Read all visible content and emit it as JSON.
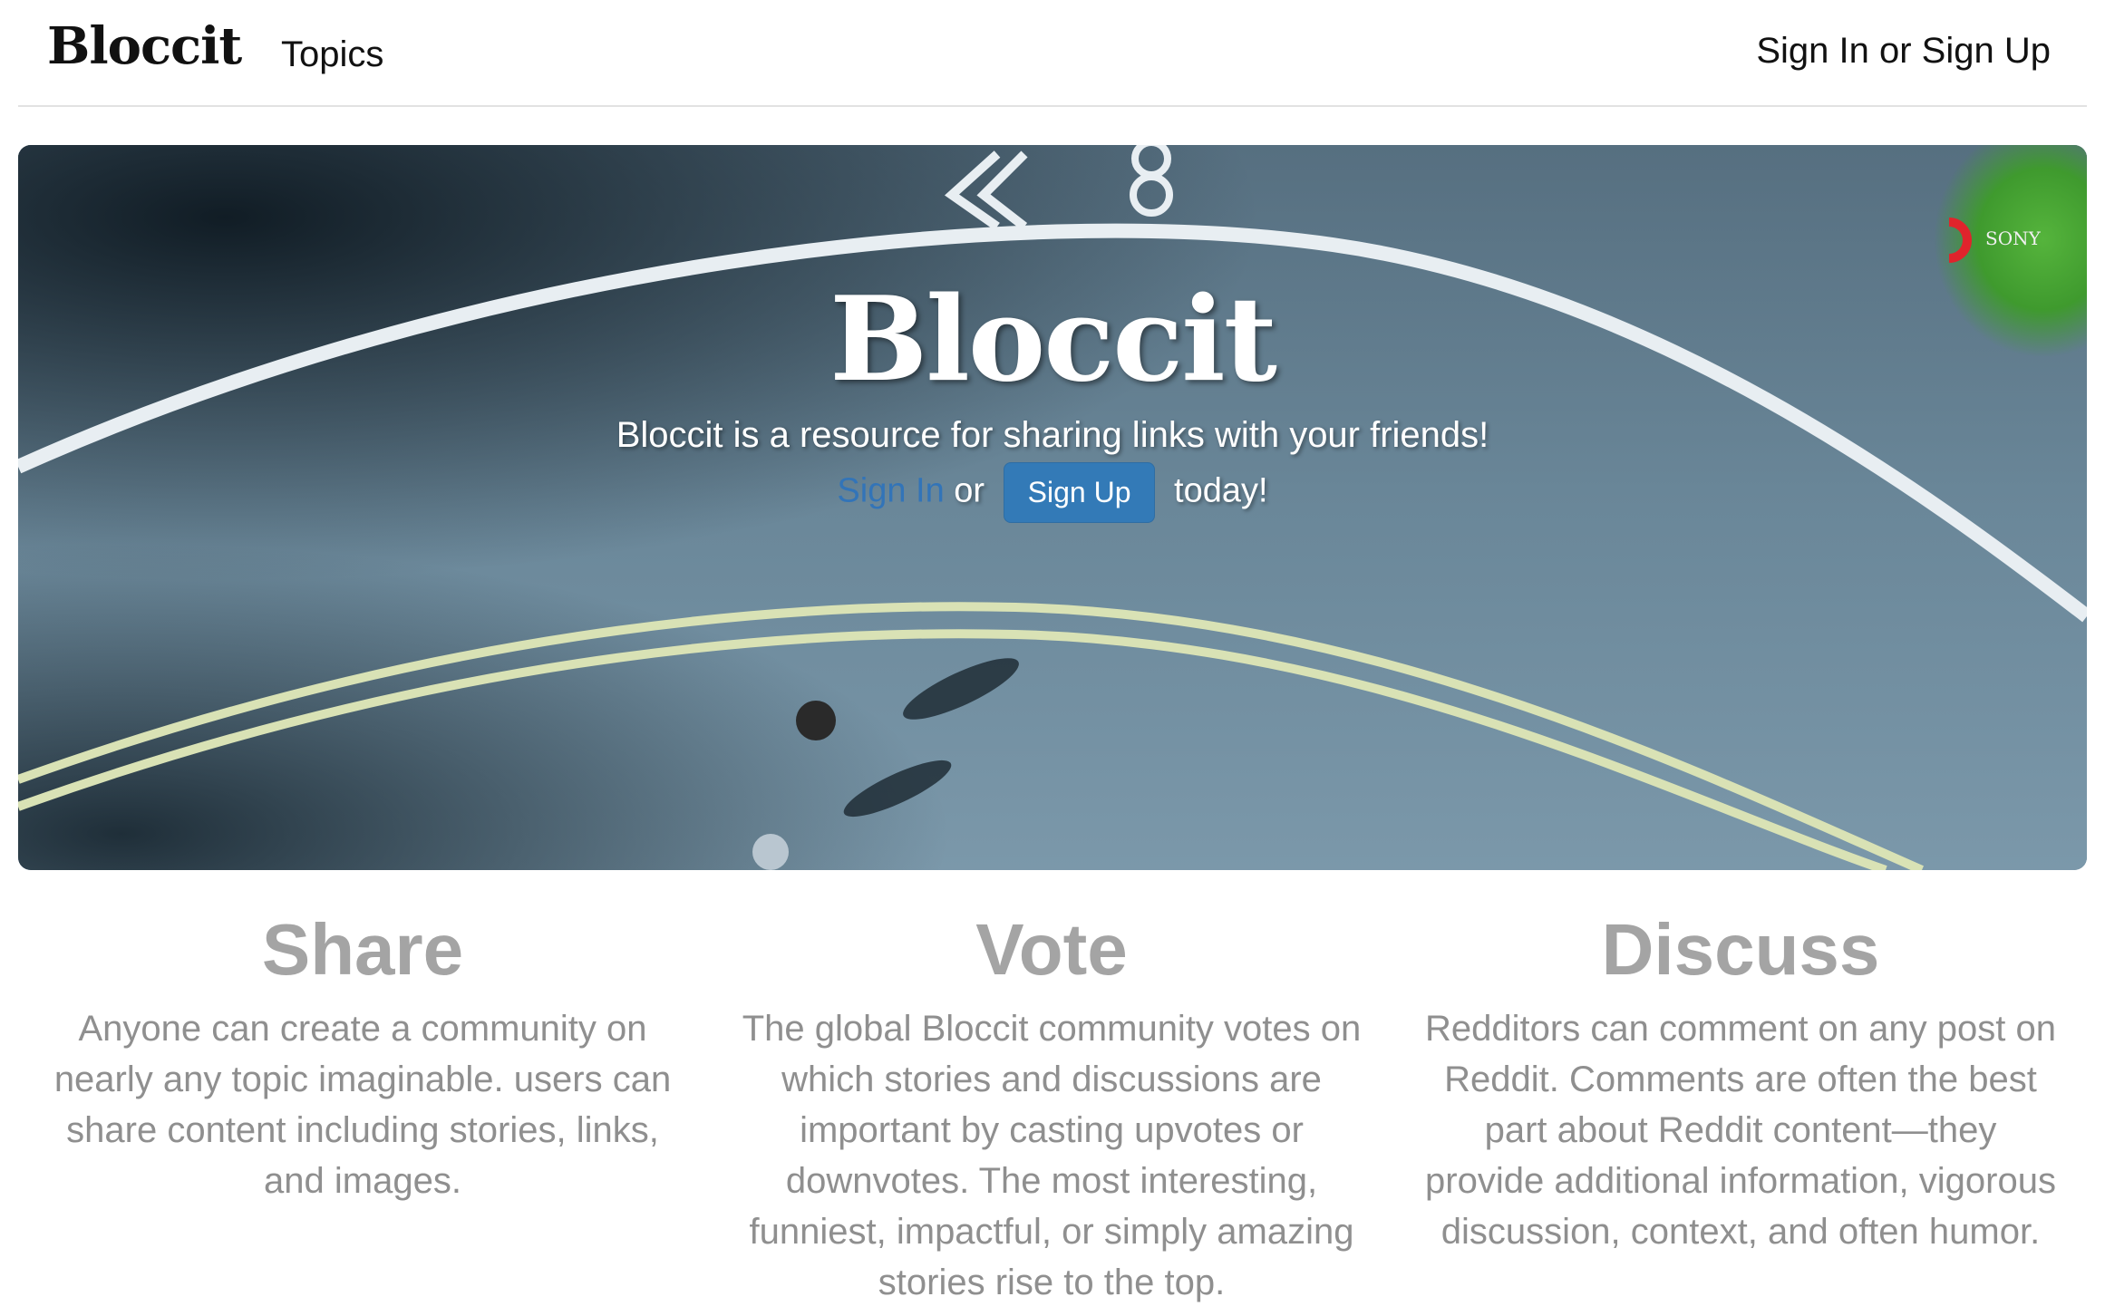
{
  "navbar": {
    "brand": "Bloccit",
    "topics_label": "Topics",
    "auth_label": "Sign In or Sign Up"
  },
  "hero": {
    "title": "Bloccit",
    "lead": "Bloccit is a resource for sharing links with your friends!",
    "signin_label": "Sign In",
    "or_text": "or",
    "signup_label": "Sign Up",
    "today_text": "today!",
    "watermark": "SONY"
  },
  "features": [
    {
      "title": "Share",
      "text": "Anyone can create a community on nearly any topic imaginable. users can share content including stories, links, and images."
    },
    {
      "title": "Vote",
      "text": "The global Bloccit community votes on which stories and discussions are important by casting upvotes or downvotes. The most interesting, funniest, impactful, or simply amazing stories rise to the top."
    },
    {
      "title": "Discuss",
      "text": "Redditors can comment on any post on Reddit. Comments are often the best part about Reddit content—they provide additional information, vigorous discussion, context, and often humor."
    }
  ],
  "colors": {
    "primary_button": "#337ab7",
    "link_blue": "#3274b8",
    "feature_heading": "#a4a4a4",
    "feature_text": "#8f8f8f"
  }
}
